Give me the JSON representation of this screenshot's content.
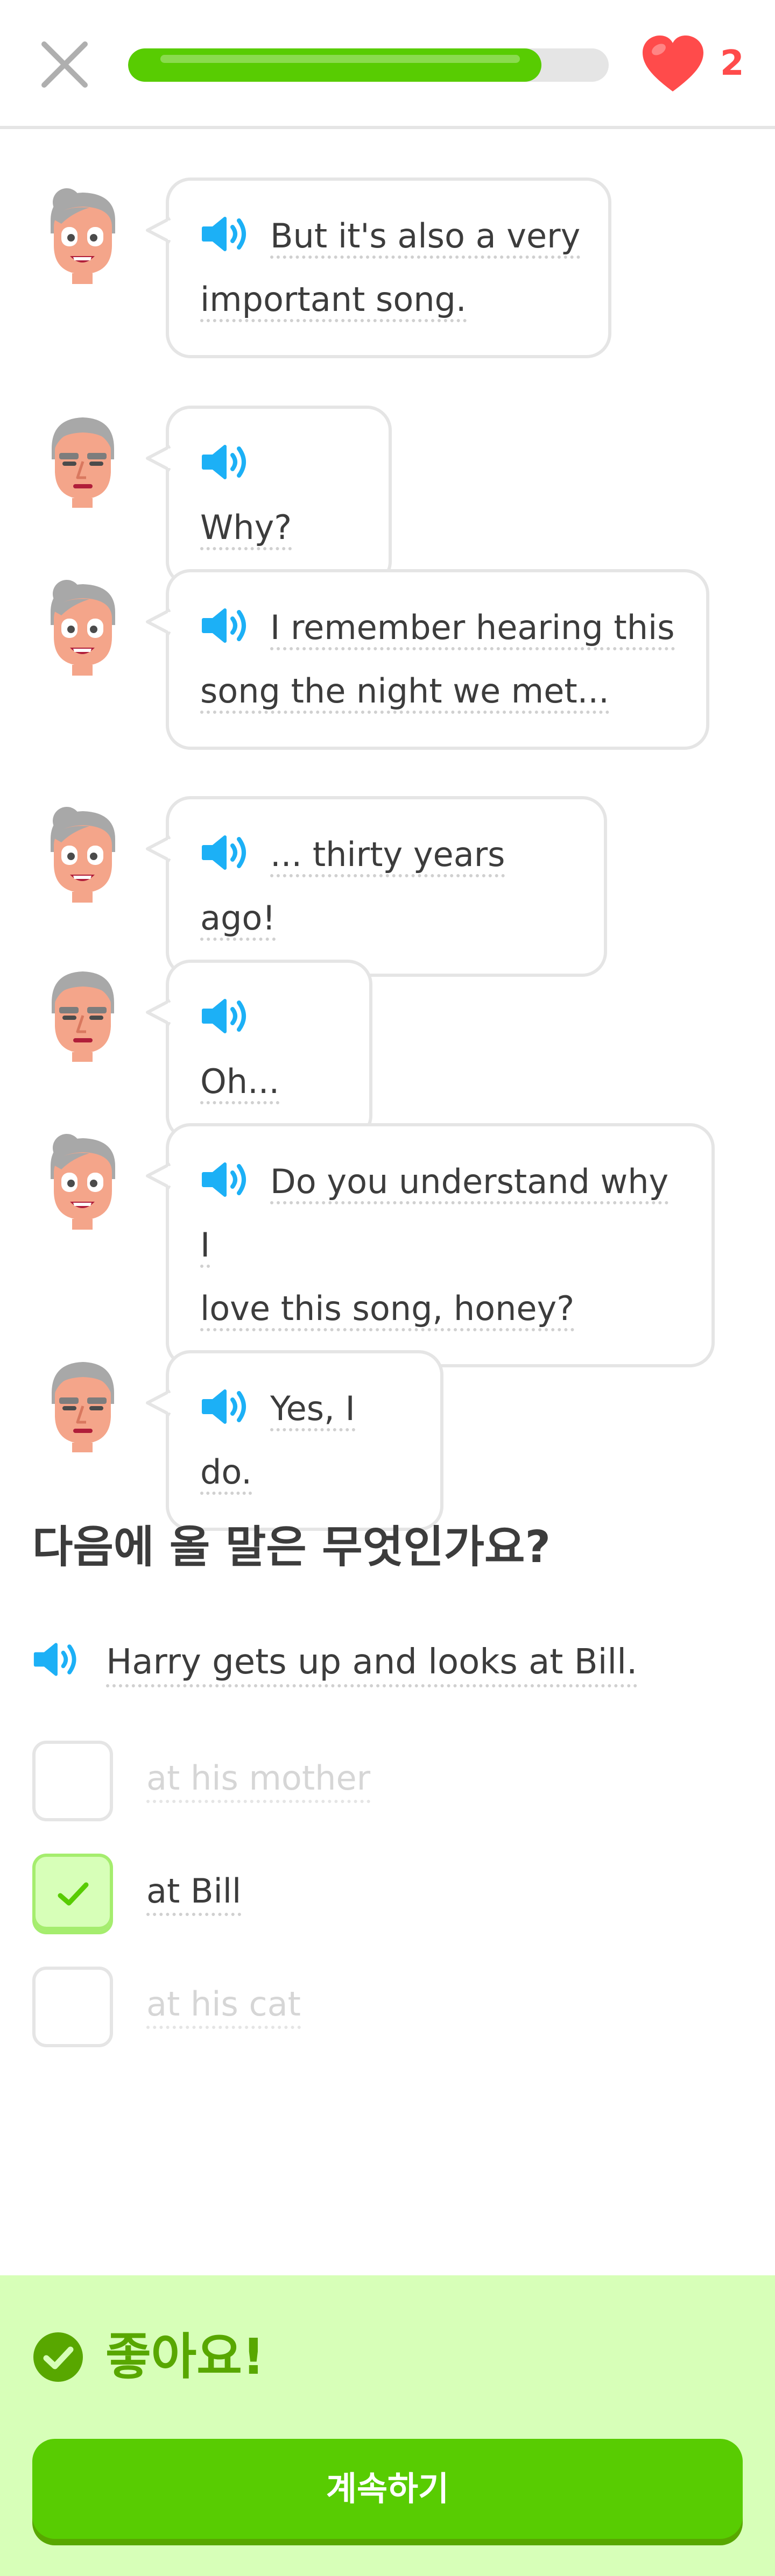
{
  "header": {
    "close_icon": "close-icon",
    "progress_fraction": 0.86,
    "hearts": "2",
    "heart_color": "#ff4b4b",
    "progress_color": "#58cc02"
  },
  "dialogue": [
    {
      "speaker": "woman",
      "lines": [
        "But it's also a very",
        "important song."
      ]
    },
    {
      "speaker": "man",
      "lines": [
        "Why?"
      ]
    },
    {
      "speaker": "woman",
      "lines": [
        "I remember hearing this",
        "song the night we met..."
      ]
    },
    {
      "speaker": "woman",
      "lines": [
        "... thirty years ago!"
      ]
    },
    {
      "speaker": "man",
      "lines": [
        "Oh..."
      ]
    },
    {
      "speaker": "woman",
      "lines": [
        "Do you understand why I",
        "love this song, honey?"
      ]
    },
    {
      "speaker": "man",
      "lines": [
        "Yes, I do."
      ]
    }
  ],
  "question": {
    "title": "다음에 올 말은 무엇인가요?",
    "sentence": "Harry gets up and looks at Bill."
  },
  "options": [
    {
      "label": "at his mother",
      "selected": false
    },
    {
      "label": "at Bill",
      "selected": true
    },
    {
      "label": "at his cat",
      "selected": false
    }
  ],
  "feedback": {
    "message": "좋아요!",
    "continue_label": "계속하기",
    "accent_color": "#58a700",
    "background_color": "#d7ffb8"
  }
}
